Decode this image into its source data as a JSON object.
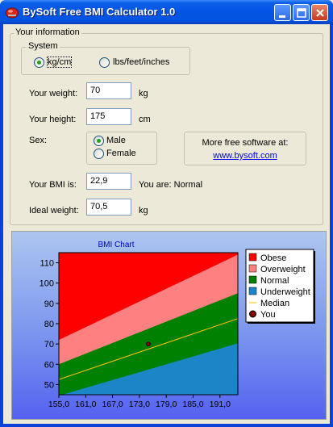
{
  "app": {
    "title": "BySoft Free BMI Calculator 1.0"
  },
  "info_group": {
    "legend": "Your information"
  },
  "system": {
    "legend": "System",
    "options": [
      {
        "label": "kg/cm",
        "checked": true
      },
      {
        "label": "lbs/feet/inches",
        "checked": false
      }
    ]
  },
  "weight": {
    "label": "Your weight:",
    "value": "70",
    "unit": "kg"
  },
  "height": {
    "label": "Your height:",
    "value": "175",
    "unit": "cm"
  },
  "sex": {
    "label": "Sex:",
    "options": [
      {
        "label": "Male",
        "checked": true
      },
      {
        "label": "Female",
        "checked": false
      }
    ]
  },
  "promo": {
    "text": "More free software at:",
    "link": "www.bysoft.com"
  },
  "bmi": {
    "label": "Your BMI is:",
    "value": "22,9",
    "result": "You are: Normal"
  },
  "ideal": {
    "label": "Ideal weight:",
    "value": "70,5",
    "unit": "kg"
  },
  "chart_data": {
    "type": "area",
    "title": "BMI Chart",
    "xlabel": "",
    "ylabel": "",
    "xlim": [
      155,
      195
    ],
    "ylim": [
      45,
      115
    ],
    "x_ticks": [
      "155,0",
      "161,0",
      "167,0",
      "173,0",
      "179,0",
      "185,0",
      "191,0"
    ],
    "y_ticks": [
      "50",
      "60",
      "70",
      "80",
      "90",
      "100",
      "110"
    ],
    "x": [
      155,
      195
    ],
    "series": [
      {
        "name": "Underweight",
        "color": "#1a86c8",
        "upper": [
          44.5,
          70.3
        ]
      },
      {
        "name": "Normal",
        "color": "#008000",
        "upper": [
          60,
          95
        ]
      },
      {
        "name": "Overweight",
        "color": "#ff8080",
        "upper": [
          72,
          114
        ]
      },
      {
        "name": "Obese",
        "color": "#ff0000",
        "upper": [
          116,
          116
        ]
      },
      {
        "name": "Median",
        "color": "#ffc000",
        "line": [
          52.5,
          82.5
        ]
      }
    ],
    "you": {
      "name": "You",
      "x": 175,
      "y": 70,
      "color": "#800000"
    },
    "legend": [
      "Obese",
      "Overweight",
      "Normal",
      "Underweight",
      "Median",
      "You"
    ],
    "legend_position": "right",
    "grid": false
  }
}
